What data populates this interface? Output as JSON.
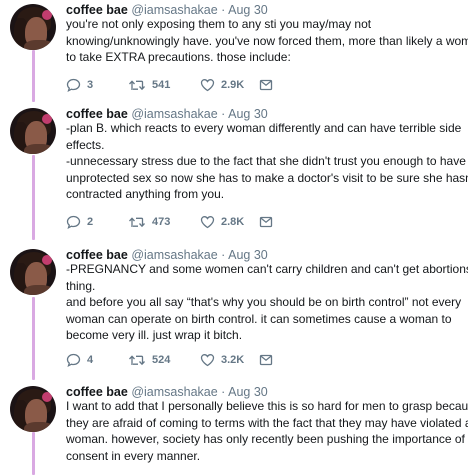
{
  "tweets": [
    {
      "name": "coffee bae",
      "handle": "@iamsashakae",
      "dot": "·",
      "date": "Aug 30",
      "lines": [
        "you're not only exposing them to any sti you may/may not",
        "knowing/unknowingly have. you've now forced them, more than likely a woman,",
        "to take EXTRA precautions. those include:"
      ],
      "replies": "3",
      "retweets": "541",
      "likes": "2.9K"
    },
    {
      "name": "coffee bae",
      "handle": "@iamsashakae",
      "dot": "·",
      "date": "Aug 30",
      "lines": [
        "-plan B. which reacts to every woman differently and can have terrible side",
        "effects.",
        "-unnecessary stress due to the fact that she didn't trust you enough to have",
        "unprotected sex so now she has to make a doctor's visit to be sure she hasn't",
        "contracted anything from you."
      ],
      "replies": "2",
      "retweets": "473",
      "likes": "2.8K"
    },
    {
      "name": "coffee bae",
      "handle": "@iamsashakae",
      "dot": "·",
      "date": "Aug 30",
      "lines": [
        "-PREGNANCY and some women can't carry children and can't get abortions. it's a",
        "thing.",
        "and before you all say “that's why you should be on birth control” not every",
        "woman can operate on birth control. it can sometimes cause a woman to",
        "become very ill. just wrap it bitch."
      ],
      "replies": "4",
      "retweets": "524",
      "likes": "3.2K"
    },
    {
      "name": "coffee bae",
      "handle": "@iamsashakae",
      "dot": "·",
      "date": "Aug 30",
      "lines": [
        "I want to add that I personally believe this is so hard for men to grasp because",
        "they are afraid of coming to terms with the fact that they may have violated a",
        "woman. however, society has only recently been pushing the importance of",
        "consent in every manner."
      ]
    }
  ],
  "icons": {
    "reply": "reply-icon",
    "retweet": "retweet-icon",
    "like": "heart-icon",
    "share": "share-icon"
  },
  "colors": {
    "thread_line": "#d9a9e2",
    "muted": "#657786",
    "text": "#14171a"
  }
}
